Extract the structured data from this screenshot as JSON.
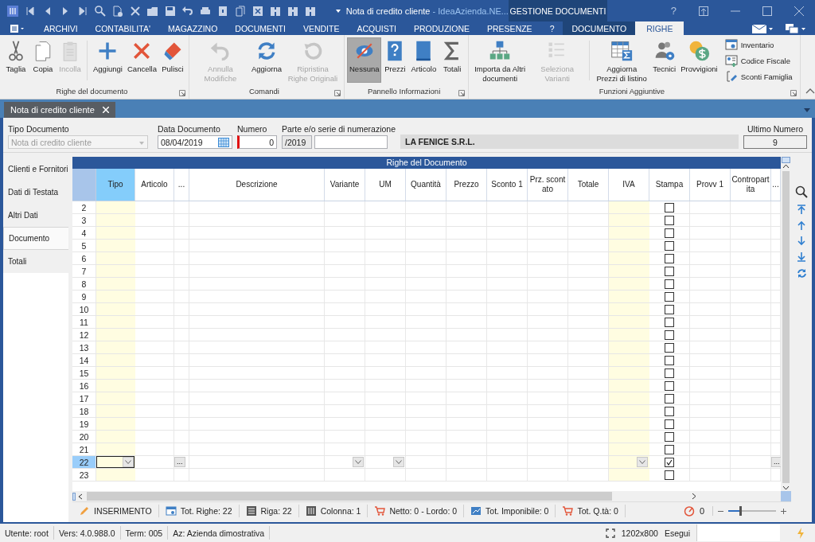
{
  "title_bar": {
    "document": "Nota di credito cliente",
    "app": " - IdeaAzienda.NE...",
    "context_tab": "GESTIONE DOCUMENTI",
    "help": "?"
  },
  "menu_tabs": [
    {
      "label": "ARCHIVI",
      "selected": false,
      "kind": "main"
    },
    {
      "label": "CONTABILITA'",
      "selected": false,
      "kind": "main"
    },
    {
      "label": "MAGAZZINO",
      "selected": false,
      "kind": "main"
    },
    {
      "label": "DOCUMENTI",
      "selected": false,
      "kind": "main"
    },
    {
      "label": "VENDITE",
      "selected": false,
      "kind": "main"
    },
    {
      "label": "ACQUISTI",
      "selected": false,
      "kind": "main"
    },
    {
      "label": "PRODUZIONE",
      "selected": false,
      "kind": "main"
    },
    {
      "label": "PRESENZE",
      "selected": false,
      "kind": "main"
    },
    {
      "label": "?",
      "selected": false,
      "kind": "main"
    },
    {
      "label": "DOCUMENTO",
      "selected": false,
      "kind": "context"
    },
    {
      "label": "RIGHE",
      "selected": true,
      "kind": "context"
    }
  ],
  "ribbon_groups": [
    {
      "label": "Righe del documento",
      "items": [
        {
          "kind": "large",
          "label": "Taglia",
          "disabled": false,
          "selected": false
        },
        {
          "kind": "large",
          "label": "Copia",
          "disabled": false,
          "selected": false
        },
        {
          "kind": "large",
          "label": "Incolla",
          "disabled": true,
          "selected": false
        },
        {
          "kind": "divider"
        },
        {
          "kind": "large",
          "label": "Aggiungi",
          "disabled": false,
          "selected": false
        },
        {
          "kind": "large",
          "label": "Cancella",
          "disabled": false,
          "selected": false
        },
        {
          "kind": "large",
          "label": "Pulisci",
          "disabled": false,
          "selected": false
        }
      ]
    },
    {
      "label": "Comandi",
      "items": [
        {
          "kind": "large",
          "label": "Annulla Modifiche",
          "disabled": true,
          "selected": false
        },
        {
          "kind": "large",
          "label": "Aggiorna",
          "disabled": false,
          "selected": false
        },
        {
          "kind": "large",
          "label": "Ripristina Righe Originali",
          "disabled": true,
          "selected": false
        }
      ]
    },
    {
      "label": "Pannello Informazioni",
      "items": [
        {
          "kind": "large",
          "label": "Nessuna",
          "disabled": false,
          "selected": true
        },
        {
          "kind": "large",
          "label": "Prezzi",
          "disabled": false,
          "selected": false
        },
        {
          "kind": "large",
          "label": "Articolo",
          "disabled": false,
          "selected": false
        },
        {
          "kind": "large",
          "label": "Totali",
          "disabled": false,
          "selected": false
        }
      ]
    },
    {
      "label": "Funzioni Aggiuntive",
      "items": [
        {
          "kind": "large",
          "label": "Importa da Altri documenti",
          "disabled": false,
          "selected": false
        },
        {
          "kind": "large",
          "label": "Seleziona Varianti",
          "disabled": true,
          "selected": false
        },
        {
          "kind": "divider"
        },
        {
          "kind": "large",
          "label": "Aggiorna Prezzi di listino",
          "disabled": false,
          "selected": false
        },
        {
          "kind": "large",
          "label": "Tecnici",
          "disabled": false,
          "selected": false
        },
        {
          "kind": "large",
          "label": "Provvigioni",
          "disabled": false,
          "selected": false
        },
        {
          "kind": "small",
          "label": "Inventario",
          "disabled": false
        },
        {
          "kind": "small",
          "label": "Codice Fiscale",
          "disabled": false
        },
        {
          "kind": "small",
          "label": "Sconti Famiglia",
          "disabled": false
        }
      ]
    }
  ],
  "document_tabs": [
    {
      "label": "Nota di credito cliente",
      "selected": true
    }
  ],
  "header_form": {
    "tipo_documento": {
      "label": "Tipo Documento",
      "value": "Nota di credito cliente",
      "disabled": true
    },
    "data_documento": {
      "label": "Data Documento",
      "value": "08/04/2019"
    },
    "numero": {
      "label": "Numero",
      "value": "0"
    },
    "serie": {
      "label": "Parte e/o serie di numerazione",
      "value": "/2019"
    },
    "cliente": "LA FENICE S.R.L.",
    "ultimo_numero": {
      "label": "Ultimo Numero",
      "value": "9"
    }
  },
  "side_nav": [
    {
      "label": "Clienti e Fornitori",
      "selected": false
    },
    {
      "label": "Dati di Testata",
      "selected": false
    },
    {
      "label": "Altri Dati",
      "selected": false
    },
    {
      "label": "Documento",
      "selected": true
    },
    {
      "label": "Totali",
      "selected": false
    }
  ],
  "grid": {
    "title": "Righe del Documento",
    "ellipsis_label": "...",
    "columns": [
      {
        "label": "Tipo",
        "kind": "text",
        "highlighted": true,
        "selected": true,
        "has_dropdown": true,
        "has_ellipsis": false
      },
      {
        "label": "Articolo",
        "kind": "text",
        "highlighted": false,
        "selected": false,
        "has_dropdown": false,
        "has_ellipsis": false
      },
      {
        "label": "...",
        "kind": "text",
        "highlighted": false,
        "selected": false,
        "has_dropdown": false,
        "has_ellipsis": true
      },
      {
        "label": "Descrizione",
        "kind": "text",
        "highlighted": false,
        "selected": false,
        "has_dropdown": false,
        "has_ellipsis": false
      },
      {
        "label": "Variante",
        "kind": "text",
        "highlighted": false,
        "selected": false,
        "has_dropdown": true,
        "has_ellipsis": false
      },
      {
        "label": "UM",
        "kind": "text",
        "highlighted": false,
        "selected": false,
        "has_dropdown": true,
        "has_ellipsis": false
      },
      {
        "label": "Quantità",
        "kind": "text",
        "highlighted": false,
        "selected": false,
        "has_dropdown": false,
        "has_ellipsis": false
      },
      {
        "label": "Prezzo",
        "kind": "text",
        "highlighted": false,
        "selected": false,
        "has_dropdown": false,
        "has_ellipsis": false
      },
      {
        "label": "Sconto 1",
        "kind": "text",
        "highlighted": false,
        "selected": false,
        "has_dropdown": false,
        "has_ellipsis": false
      },
      {
        "label": "Prz. scontato",
        "kind": "text",
        "highlighted": false,
        "selected": false,
        "has_dropdown": false,
        "has_ellipsis": false
      },
      {
        "label": "Totale",
        "kind": "text",
        "highlighted": false,
        "selected": false,
        "has_dropdown": false,
        "has_ellipsis": false
      },
      {
        "label": "IVA",
        "kind": "text",
        "highlighted": true,
        "selected": false,
        "has_dropdown": true,
        "has_ellipsis": false
      },
      {
        "label": "Stampa",
        "kind": "checkbox",
        "highlighted": false,
        "selected": false,
        "has_dropdown": false,
        "has_ellipsis": false
      },
      {
        "label": "Provv 1",
        "kind": "text",
        "highlighted": false,
        "selected": false,
        "has_dropdown": false,
        "has_ellipsis": false
      },
      {
        "label": "Contropartita",
        "kind": "text",
        "highlighted": false,
        "selected": false,
        "has_dropdown": false,
        "has_ellipsis": false
      },
      {
        "label": "...",
        "kind": "text",
        "highlighted": false,
        "selected": false,
        "has_dropdown": false,
        "has_ellipsis": true
      }
    ],
    "rows": [
      {
        "number": "2",
        "checked": false,
        "selected": false
      },
      {
        "number": "3",
        "checked": false,
        "selected": false
      },
      {
        "number": "4",
        "checked": false,
        "selected": false
      },
      {
        "number": "5",
        "checked": false,
        "selected": false
      },
      {
        "number": "6",
        "checked": false,
        "selected": false
      },
      {
        "number": "7",
        "checked": false,
        "selected": false
      },
      {
        "number": "8",
        "checked": false,
        "selected": false
      },
      {
        "number": "9",
        "checked": false,
        "selected": false
      },
      {
        "number": "10",
        "checked": false,
        "selected": false
      },
      {
        "number": "11",
        "checked": false,
        "selected": false
      },
      {
        "number": "12",
        "checked": false,
        "selected": false
      },
      {
        "number": "13",
        "checked": false,
        "selected": false
      },
      {
        "number": "14",
        "checked": false,
        "selected": false
      },
      {
        "number": "15",
        "checked": false,
        "selected": false
      },
      {
        "number": "16",
        "checked": false,
        "selected": false
      },
      {
        "number": "17",
        "checked": false,
        "selected": false
      },
      {
        "number": "18",
        "checked": false,
        "selected": false
      },
      {
        "number": "19",
        "checked": false,
        "selected": false
      },
      {
        "number": "20",
        "checked": false,
        "selected": false
      },
      {
        "number": "21",
        "checked": false,
        "selected": false
      },
      {
        "number": "22",
        "checked": true,
        "selected": true
      },
      {
        "number": "23",
        "checked": false,
        "selected": false
      }
    ]
  },
  "status_bar": {
    "items": [
      "INSERIMENTO",
      "Tot. Righe: 22",
      "Riga: 22",
      "Colonna: 1",
      "Netto: 0 - Lordo: 0",
      "Tot. Imponibile: 0",
      "Tot. Q.tà: 0"
    ],
    "counter": "0",
    "zoom": {
      "level": 0.25
    }
  },
  "bottom_bar": {
    "items": [
      "Utente: root",
      "Vers: 4.0.988.0",
      "Term: 005",
      "Az: Azienda dimostrativa"
    ],
    "resolution": "1202x800",
    "run_label": "Esegui"
  }
}
